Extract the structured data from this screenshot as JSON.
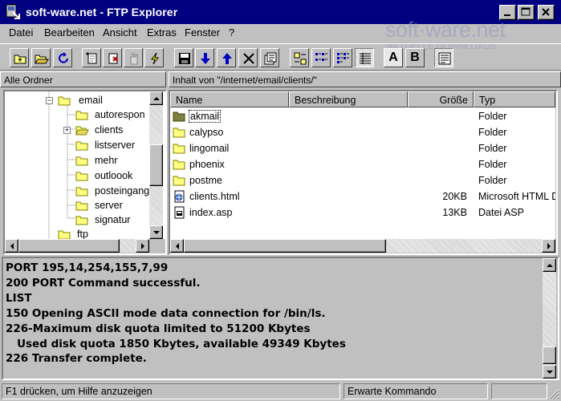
{
  "window": {
    "title": "soft-ware.net - FTP Explorer"
  },
  "watermark": {
    "main": "soft·ware.net",
    "sub": "AKTUELLE DOWNLOADS"
  },
  "menu": [
    {
      "label": "Datei"
    },
    {
      "label": "Bearbeiten"
    },
    {
      "label": "Ansicht"
    },
    {
      "label": "Extras"
    },
    {
      "label": "Fenster"
    },
    {
      "label": "?"
    }
  ],
  "toolbar": {
    "buttons": [
      "connect-icon",
      "open-folder-icon",
      "refresh-icon",
      "cut-icon",
      "delete-icon",
      "stop-icon",
      "properties-icon",
      "save-icon",
      "download-icon",
      "upload-icon",
      "delete-x-icon",
      "folder-properties-icon",
      "large-icons-view-icon",
      "small-icons-view-icon",
      "list-view-icon",
      "details-view-icon",
      "ascii-mode-icon",
      "binary-mode-icon",
      "log-view-icon"
    ],
    "ascii_label": "A",
    "binary_label": "B"
  },
  "left_pane": {
    "header": "Alle Ordner",
    "tree": [
      {
        "label": "email",
        "expander": "−",
        "level": 0
      },
      {
        "label": "autorespon",
        "level": 1
      },
      {
        "label": "clients",
        "expander": "+",
        "level": 1,
        "open": true
      },
      {
        "label": "listserver",
        "level": 1
      },
      {
        "label": "mehr",
        "level": 1
      },
      {
        "label": "outloook",
        "level": 1
      },
      {
        "label": "posteingang",
        "level": 1
      },
      {
        "label": "server",
        "level": 1
      },
      {
        "label": "signatur",
        "level": 1
      },
      {
        "label": "ftp",
        "level": 0
      }
    ]
  },
  "right_pane": {
    "header": "Inhalt von \"/internet/email/clients/\"",
    "columns": {
      "name": "Name",
      "desc": "Beschreibung",
      "size": "Größe",
      "type": "Typ"
    },
    "rows": [
      {
        "name": "akmail",
        "size": "",
        "type": "Folder",
        "icon": "folder-icon",
        "selected": true
      },
      {
        "name": "calypso",
        "size": "",
        "type": "Folder",
        "icon": "folder-icon"
      },
      {
        "name": "lingomail",
        "size": "",
        "type": "Folder",
        "icon": "folder-icon"
      },
      {
        "name": "phoenix",
        "size": "",
        "type": "Folder",
        "icon": "folder-icon"
      },
      {
        "name": "postme",
        "size": "",
        "type": "Folder",
        "icon": "folder-icon"
      },
      {
        "name": "clients.html",
        "size": "20KB",
        "type": "Microsoft HTML D",
        "icon": "html-file-icon"
      },
      {
        "name": "index.asp",
        "size": "13KB",
        "type": "Datei ASP",
        "icon": "asp-file-icon"
      }
    ]
  },
  "log": [
    "PORT 195,14,254,155,7,99",
    "200 PORT Command successful.",
    "LIST",
    "150 Opening ASCII mode data connection for /bin/ls.",
    "226-Maximum disk quota limited to 51200 Kbytes",
    "   Used disk quota 1850 Kbytes, available 49349 Kbytes",
    "226 Transfer complete."
  ],
  "status": {
    "help": "F1 drücken, um Hilfe anzuzeigen",
    "state": "Erwarte Kommando"
  },
  "colors": {
    "titlebar": "#000080",
    "face": "#c0c0c0",
    "folder": "#ffff80"
  }
}
